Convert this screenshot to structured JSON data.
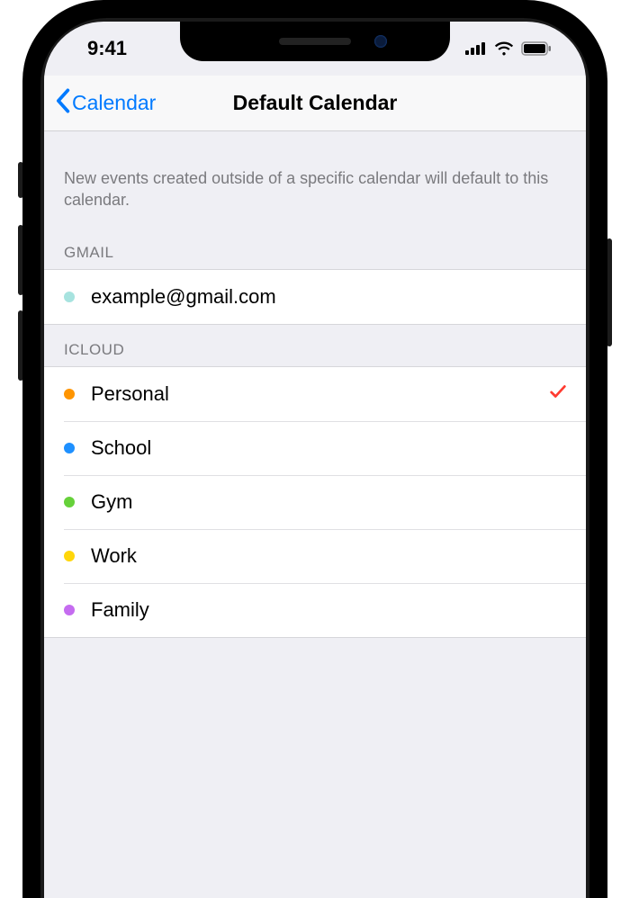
{
  "status": {
    "time": "9:41"
  },
  "nav": {
    "back_label": "Calendar",
    "title": "Default Calendar"
  },
  "description": "New events created outside of a specific calendar will default to this calendar.",
  "sections": [
    {
      "header": "GMAIL",
      "items": [
        {
          "label": "example@gmail.com",
          "color": "#a7e3df",
          "selected": false
        }
      ]
    },
    {
      "header": "ICLOUD",
      "items": [
        {
          "label": "Personal",
          "color": "#ff9500",
          "selected": true
        },
        {
          "label": "School",
          "color": "#1e90ff",
          "selected": false
        },
        {
          "label": "Gym",
          "color": "#66d13a",
          "selected": false
        },
        {
          "label": "Work",
          "color": "#ffd60a",
          "selected": false
        },
        {
          "label": "Family",
          "color": "#c56cf0",
          "selected": false
        }
      ]
    }
  ]
}
